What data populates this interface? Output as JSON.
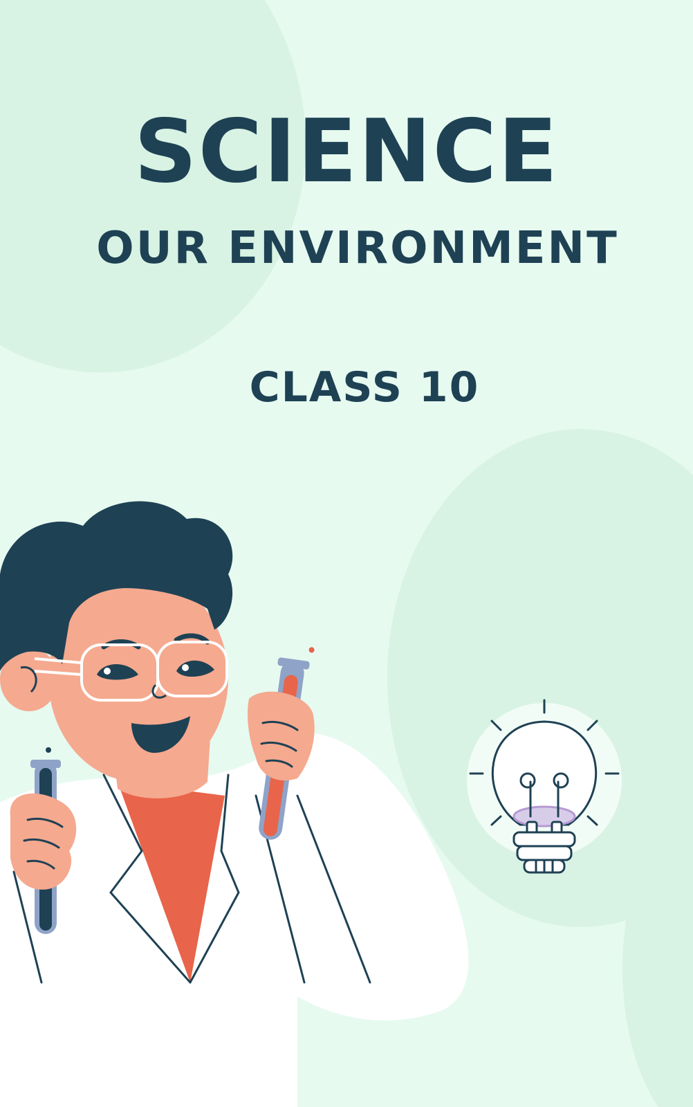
{
  "cover": {
    "title": "SCIENCE",
    "subtitle": "OUR ENVIRONMENT",
    "class_label": "CLASS 10"
  },
  "illustrations": {
    "scientist": "scientist-holding-test-tubes",
    "bulb": "light-bulb-icon"
  },
  "colors": {
    "background": "#e6faf0",
    "text": "#1e4154",
    "accent": "#e8644a"
  }
}
